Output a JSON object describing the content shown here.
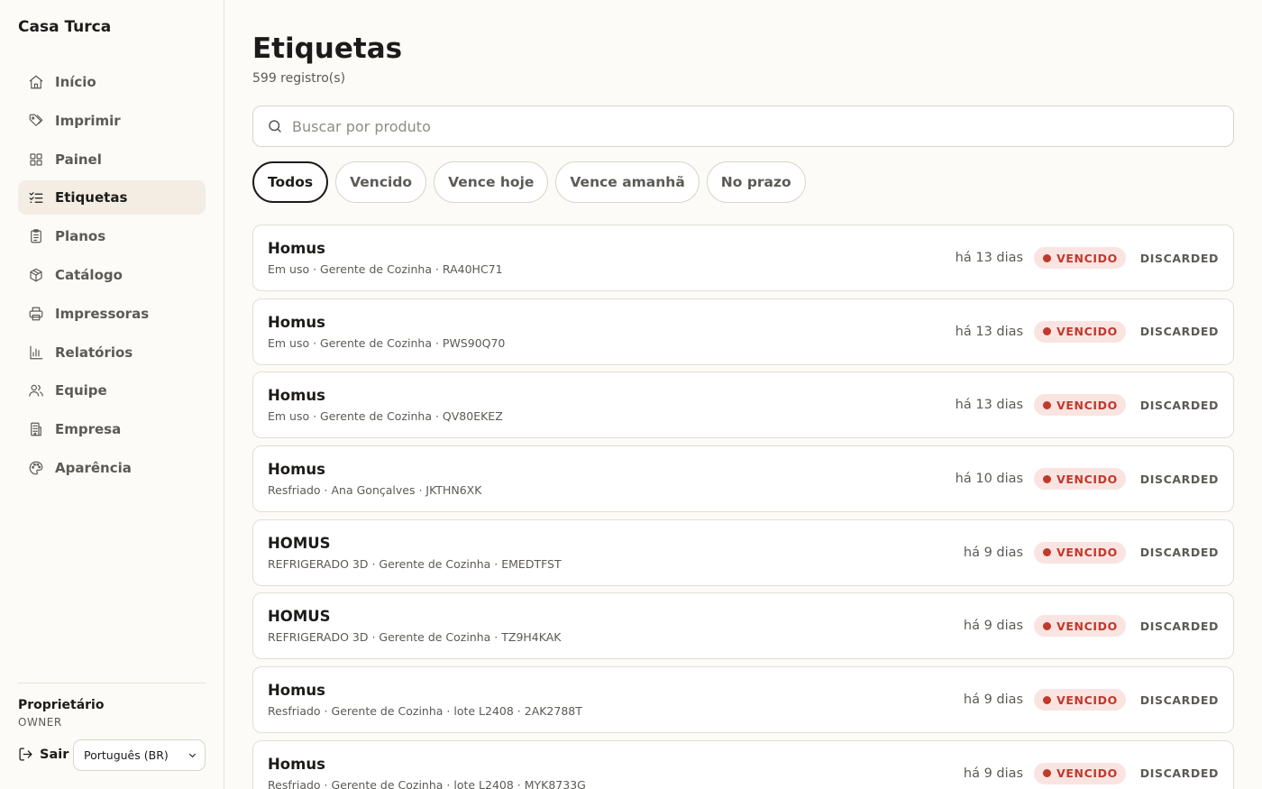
{
  "app": {
    "title": "Casa Turca"
  },
  "sidebar": {
    "items": [
      {
        "label": "Início",
        "icon": "home-icon",
        "active": false
      },
      {
        "label": "Imprimir",
        "icon": "tag-icon",
        "active": false
      },
      {
        "label": "Painel",
        "icon": "grid-icon",
        "active": false
      },
      {
        "label": "Etiquetas",
        "icon": "list-checks-icon",
        "active": true
      },
      {
        "label": "Planos",
        "icon": "clipboard-icon",
        "active": false
      },
      {
        "label": "Catálogo",
        "icon": "package-icon",
        "active": false
      },
      {
        "label": "Impressoras",
        "icon": "printer-icon",
        "active": false
      },
      {
        "label": "Relatórios",
        "icon": "bar-chart-icon",
        "active": false
      },
      {
        "label": "Equipe",
        "icon": "users-icon",
        "active": false
      },
      {
        "label": "Empresa",
        "icon": "building-icon",
        "active": false
      },
      {
        "label": "Aparência",
        "icon": "palette-icon",
        "active": false
      }
    ],
    "user": {
      "name": "Proprietário",
      "role": "OWNER"
    },
    "logout_label": "Sair",
    "language": {
      "selected": "Português (BR)"
    }
  },
  "main": {
    "title": "Etiquetas",
    "count": "599 registro(s)",
    "search": {
      "placeholder": "Buscar por produto",
      "value": ""
    },
    "filters": [
      {
        "label": "Todos",
        "active": true
      },
      {
        "label": "Vencido",
        "active": false
      },
      {
        "label": "Vence hoje",
        "active": false
      },
      {
        "label": "Vence amanhã",
        "active": false
      },
      {
        "label": "No prazo",
        "active": false
      }
    ],
    "rows": [
      {
        "title": "Homus",
        "subtitle": "Em uso · Gerente de Cozinha · RA40HC71",
        "time": "há 13 dias",
        "badge": "VENCIDO",
        "status": "DISCARDED"
      },
      {
        "title": "Homus",
        "subtitle": "Em uso · Gerente de Cozinha · PWS90Q70",
        "time": "há 13 dias",
        "badge": "VENCIDO",
        "status": "DISCARDED"
      },
      {
        "title": "Homus",
        "subtitle": "Em uso · Gerente de Cozinha · QV80EKEZ",
        "time": "há 13 dias",
        "badge": "VENCIDO",
        "status": "DISCARDED"
      },
      {
        "title": "Homus",
        "subtitle": "Resfriado · Ana Gonçalves · JKTHN6XK",
        "time": "há 10 dias",
        "badge": "VENCIDO",
        "status": "DISCARDED"
      },
      {
        "title": "HOMUS",
        "subtitle": "REFRIGERADO 3D · Gerente de Cozinha · EMEDTFST",
        "time": "há 9 dias",
        "badge": "VENCIDO",
        "status": "DISCARDED"
      },
      {
        "title": "HOMUS",
        "subtitle": "REFRIGERADO 3D · Gerente de Cozinha · TZ9H4KAK",
        "time": "há 9 dias",
        "badge": "VENCIDO",
        "status": "DISCARDED"
      },
      {
        "title": "Homus",
        "subtitle": "Resfriado · Gerente de Cozinha · lote L2408 · 2AK2788T",
        "time": "há 9 dias",
        "badge": "VENCIDO",
        "status": "DISCARDED"
      },
      {
        "title": "Homus",
        "subtitle": "Resfriado · Gerente de Cozinha · lote L2408 · MYK8733G",
        "time": "há 9 dias",
        "badge": "VENCIDO",
        "status": "DISCARDED"
      }
    ]
  },
  "colors": {
    "background": "#fcfbf7",
    "active_nav": "#f3ede3",
    "badge_bg": "#f9e4e2",
    "badge_text": "#c0392b",
    "text": "#1c1b19",
    "muted": "#5c5a55"
  }
}
